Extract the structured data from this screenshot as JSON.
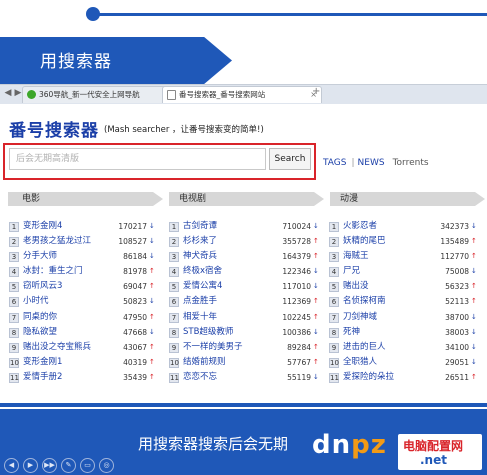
{
  "slide": {
    "banner_title": "用搜索器"
  },
  "browser": {
    "tabs": [
      {
        "label": "360导航_新一代安全上网导航",
        "active": false
      },
      {
        "label": "番号搜索器_番号搜索网站",
        "active": true
      }
    ],
    "add_tab": "+"
  },
  "site": {
    "logo": "番号搜索器",
    "slogan": "(Mash searcher ，让番号搜索变的简单!)",
    "search_placeholder": "后会无期高清版",
    "search_button": "Search",
    "links": [
      "TAGS",
      "NEWS",
      "Torrents"
    ]
  },
  "columns": [
    {
      "header": "电影",
      "items": [
        {
          "rank": "1",
          "title": "变形金刚4",
          "count": "170217",
          "trend": "down"
        },
        {
          "rank": "2",
          "title": "老男孩之猛龙过江",
          "count": "108527",
          "trend": "down"
        },
        {
          "rank": "3",
          "title": "分手大师",
          "count": "86184",
          "trend": "down"
        },
        {
          "rank": "4",
          "title": "冰封：重生之门",
          "count": "81978",
          "trend": "up"
        },
        {
          "rank": "5",
          "title": "窃听风云3",
          "count": "69047",
          "trend": "up"
        },
        {
          "rank": "6",
          "title": "小时代",
          "count": "50823",
          "trend": "down"
        },
        {
          "rank": "7",
          "title": "同桌的你",
          "count": "47950",
          "trend": "up"
        },
        {
          "rank": "8",
          "title": "隐私欲望",
          "count": "47668",
          "trend": "down"
        },
        {
          "rank": "9",
          "title": "赌出没之夺宝熊兵",
          "count": "43067",
          "trend": "up"
        },
        {
          "rank": "10",
          "title": "变形金刚1",
          "count": "40319",
          "trend": "up"
        },
        {
          "rank": "11",
          "title": "爱情手册2",
          "count": "35439",
          "trend": "up"
        }
      ]
    },
    {
      "header": "电视剧",
      "items": [
        {
          "rank": "1",
          "title": "古剑奇谭",
          "count": "710024",
          "trend": "down"
        },
        {
          "rank": "2",
          "title": "杉杉来了",
          "count": "355728",
          "trend": "up"
        },
        {
          "rank": "3",
          "title": "神犬奇兵",
          "count": "164379",
          "trend": "up"
        },
        {
          "rank": "4",
          "title": "终极x宿舍",
          "count": "122346",
          "trend": "down"
        },
        {
          "rank": "5",
          "title": "爱情公寓4",
          "count": "117010",
          "trend": "down"
        },
        {
          "rank": "6",
          "title": "点金胜手",
          "count": "112369",
          "trend": "up"
        },
        {
          "rank": "7",
          "title": "相爱十年",
          "count": "102245",
          "trend": "up"
        },
        {
          "rank": "8",
          "title": "STB超级教师",
          "count": "100386",
          "trend": "down"
        },
        {
          "rank": "9",
          "title": "不一样的美男子",
          "count": "89284",
          "trend": "up"
        },
        {
          "rank": "10",
          "title": "结婚前规则",
          "count": "57767",
          "trend": "up"
        },
        {
          "rank": "11",
          "title": "恋恋不忘",
          "count": "55119",
          "trend": "down"
        }
      ]
    },
    {
      "header": "动漫",
      "items": [
        {
          "rank": "1",
          "title": "火影忍者",
          "count": "342373",
          "trend": "down"
        },
        {
          "rank": "2",
          "title": "妖精的尾巴",
          "count": "135489",
          "trend": "up"
        },
        {
          "rank": "3",
          "title": "海贼王",
          "count": "112770",
          "trend": "up"
        },
        {
          "rank": "4",
          "title": "尸兄",
          "count": "75008",
          "trend": "down"
        },
        {
          "rank": "5",
          "title": "赌出没",
          "count": "56323",
          "trend": "up"
        },
        {
          "rank": "6",
          "title": "名侦探柯南",
          "count": "52113",
          "trend": "up"
        },
        {
          "rank": "7",
          "title": "刀剑神域",
          "count": "38700",
          "trend": "down"
        },
        {
          "rank": "8",
          "title": "死神",
          "count": "38003",
          "trend": "down"
        },
        {
          "rank": "9",
          "title": "进击的巨人",
          "count": "34100",
          "trend": "down"
        },
        {
          "rank": "10",
          "title": "全职猎人",
          "count": "29051",
          "trend": "down"
        },
        {
          "rank": "11",
          "title": "爱探险的朵拉",
          "count": "26511",
          "trend": "up"
        }
      ]
    }
  ],
  "footer": {
    "caption": "用搜索器搜索后会无期"
  },
  "watermark": {
    "logo_left": "dn",
    "logo_accent": "pz",
    "cn": "电脑配置网",
    "net": ".net"
  },
  "icons": {
    "trend_up": "↑",
    "trend_down": "↓",
    "controls": [
      "◀",
      "▶",
      "▶▶",
      "✎",
      "▭",
      "◎"
    ]
  },
  "colors": {
    "brand_blue": "#1f58b8",
    "highlight_red": "#d9242a",
    "link_blue": "#1b3fa8"
  }
}
